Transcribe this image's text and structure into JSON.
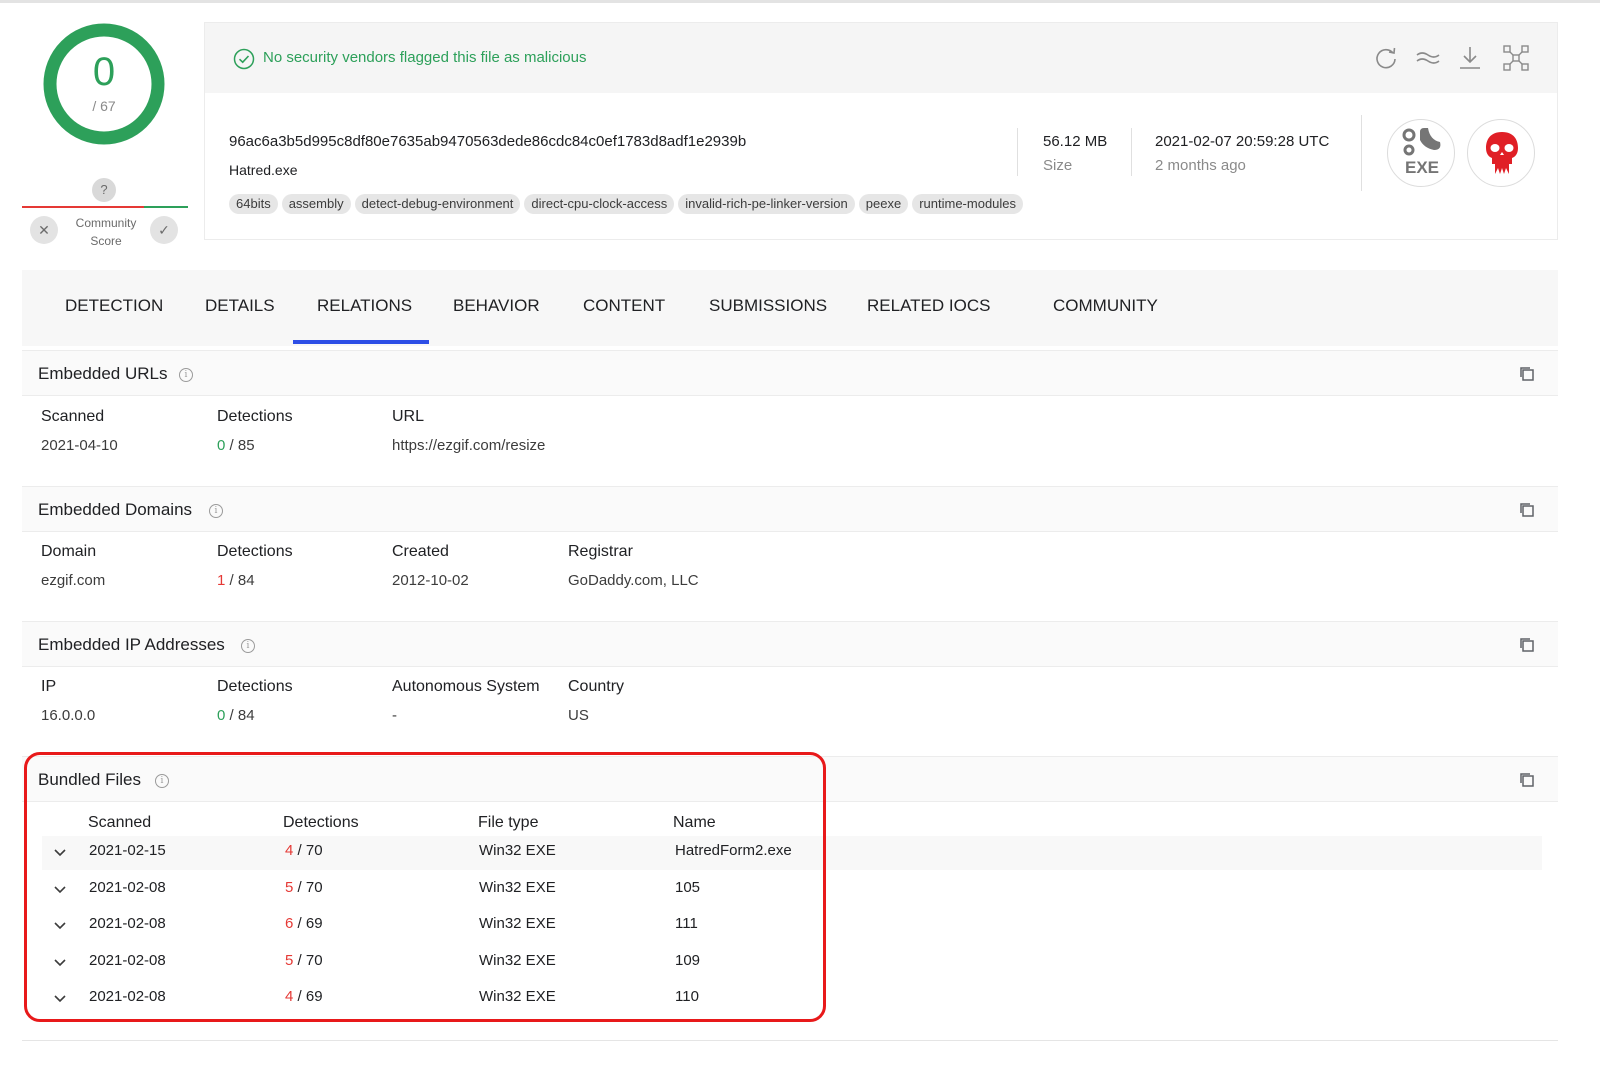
{
  "score": {
    "detected": "0",
    "total": "/ 67",
    "ring_color": "#2da05a"
  },
  "community": {
    "unknown": "?",
    "label_line1": "Community",
    "label_line2": "Score",
    "dislike": "✕",
    "like": "✓"
  },
  "banner": {
    "text": "No security vendors flagged this file as malicious"
  },
  "file": {
    "hash": "96ac6a3b5d995c8df80e7635ab9470563dede86cdc84c0ef1783d8adf1e2939b",
    "name": "Hatred.exe",
    "tags": [
      "64bits",
      "assembly",
      "detect-debug-environment",
      "direct-cpu-clock-access",
      "invalid-rich-pe-linker-version",
      "peexe",
      "runtime-modules"
    ],
    "size": "56.12 MB",
    "size_label": "Size",
    "date": "2021-02-07 20:59:28 UTC",
    "date_ago": "2 months ago",
    "type_badge": "EXE"
  },
  "tabs": [
    "DETECTION",
    "DETAILS",
    "RELATIONS",
    "BEHAVIOR",
    "CONTENT",
    "SUBMISSIONS",
    "RELATED IOCS",
    "COMMUNITY"
  ],
  "active_tab": "RELATIONS",
  "embedded_urls": {
    "title": "Embedded URLs",
    "headers": [
      "Scanned",
      "Detections",
      "URL"
    ],
    "row": {
      "scanned": "2021-04-10",
      "det": "0",
      "det_total": " / 85",
      "url": "https://ezgif.com/resize"
    }
  },
  "embedded_domains": {
    "title": "Embedded Domains",
    "headers": [
      "Domain",
      "Detections",
      "Created",
      "Registrar"
    ],
    "row": {
      "domain": "ezgif.com",
      "det": "1",
      "det_total": " / 84",
      "created": "2012-10-02",
      "registrar": "GoDaddy.com, LLC"
    }
  },
  "embedded_ips": {
    "title": "Embedded IP Addresses",
    "headers": [
      "IP",
      "Detections",
      "Autonomous System",
      "Country"
    ],
    "row": {
      "ip": "16.0.0.0",
      "det": "0",
      "det_total": " / 84",
      "as": "-",
      "country": "US"
    }
  },
  "bundled_files": {
    "title": "Bundled Files",
    "headers": [
      "Scanned",
      "Detections",
      "File type",
      "Name"
    ],
    "rows": [
      {
        "scanned": "2021-02-15",
        "det": "4",
        "det_total": " / 70",
        "type": "Win32 EXE",
        "name": "HatredForm2.exe"
      },
      {
        "scanned": "2021-02-08",
        "det": "5",
        "det_total": " / 70",
        "type": "Win32 EXE",
        "name": "105"
      },
      {
        "scanned": "2021-02-08",
        "det": "6",
        "det_total": " / 69",
        "type": "Win32 EXE",
        "name": "111"
      },
      {
        "scanned": "2021-02-08",
        "det": "5",
        "det_total": " / 70",
        "type": "Win32 EXE",
        "name": "109"
      },
      {
        "scanned": "2021-02-08",
        "det": "4",
        "det_total": " / 69",
        "type": "Win32 EXE",
        "name": "110"
      }
    ]
  },
  "colors": {
    "accent": "#2d4ee6",
    "clean": "#2da05a",
    "malicious": "#e53935",
    "highlight": "#e8191a"
  }
}
